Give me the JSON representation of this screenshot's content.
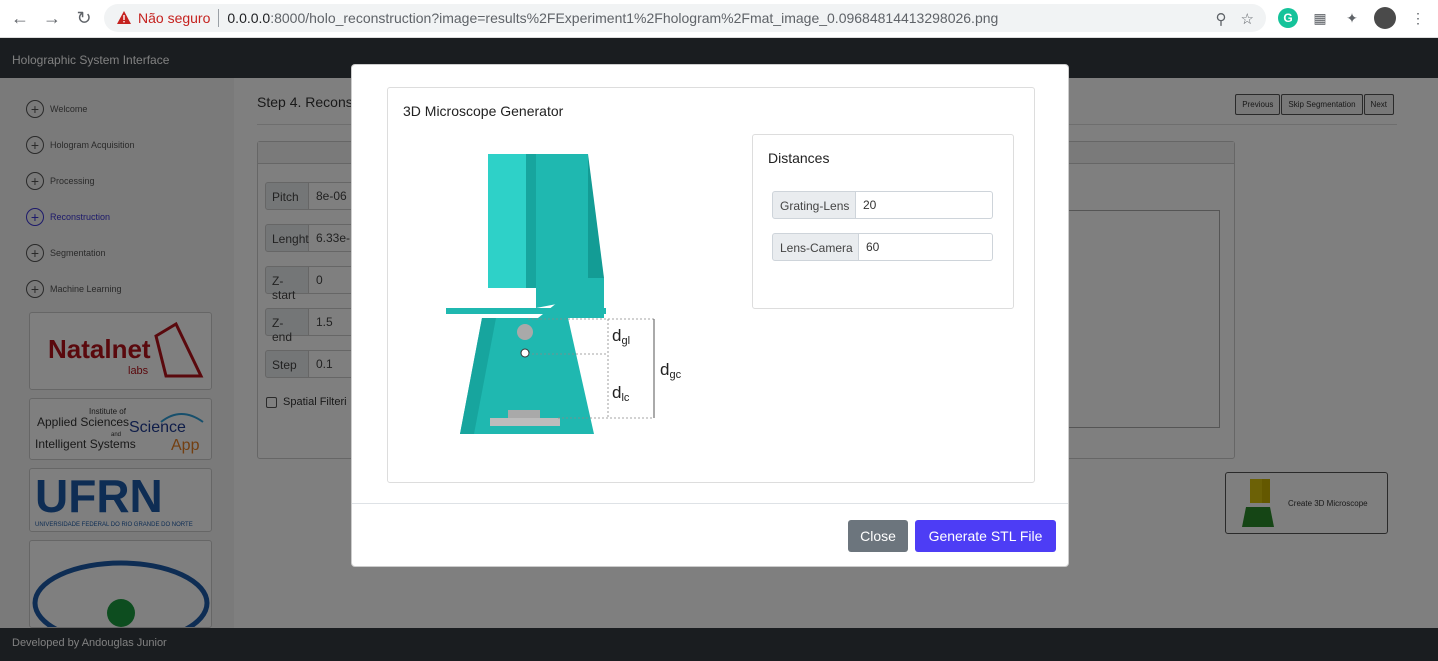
{
  "browser": {
    "insecure_label": "Não seguro",
    "url_host": "0.0.0.0",
    "url_path": ":8000/holo_reconstruction?image=results%2FExperiment1%2Fhologram%2Fmat_image_0.09684814413298026.png"
  },
  "app": {
    "title": "Holographic System Interface",
    "footer": "Developed by Andouglas Junior"
  },
  "sidebar": {
    "items": [
      {
        "label": "Welcome"
      },
      {
        "label": "Hologram Acquisition"
      },
      {
        "label": "Processing"
      },
      {
        "label": "Reconstruction"
      },
      {
        "label": "Segmentation"
      },
      {
        "label": "Machine Learning"
      }
    ],
    "logos": {
      "natalnet": "Natalnet",
      "natalnet_sub": "labs",
      "science_app_1": "Institute of",
      "science_app_2": "Applied Sciences",
      "science_app_3": "and",
      "science_app_4": "Intelligent Systems",
      "science_app_5": "Science",
      "science_app_6": "App",
      "ufrn": "UFRN",
      "ufrn_sub": "UNIVERSIDADE FEDERAL DO RIO GRANDE DO NORTE"
    }
  },
  "main": {
    "step_title": "Step 4. Recons",
    "buttons": {
      "previous": "Previous",
      "skip": "Skip Segmentation",
      "next": "Next"
    },
    "fields": [
      {
        "label": "Pitch",
        "value": "8e-06"
      },
      {
        "label": "Lenght",
        "value": "6.33e-"
      },
      {
        "label": "Z-start",
        "value": "0"
      },
      {
        "label": "Z-end",
        "value": "1.5"
      },
      {
        "label": "Step",
        "value": "0.1"
      }
    ],
    "spatial_label": "Spatial Filteri",
    "create_card_label": "Create 3D Microscope"
  },
  "modal": {
    "title": "3D Microscope Generator",
    "illustration_labels": {
      "dgl": "d",
      "dgl_sub": "gl",
      "dlc": "d",
      "dlc_sub": "lc",
      "dgc": "d",
      "dgc_sub": "gc"
    },
    "distances": {
      "title": "Distances",
      "fields": [
        {
          "label": "Grating-Lens",
          "value": "20"
        },
        {
          "label": "Lens-Camera",
          "value": "60"
        }
      ]
    },
    "close_label": "Close",
    "generate_label": "Generate STL File"
  },
  "colors": {
    "teal": "#1fb8b0",
    "teal_dark": "#139c95",
    "accent": "#4d3df5",
    "active_nav": "#3b35d6"
  }
}
